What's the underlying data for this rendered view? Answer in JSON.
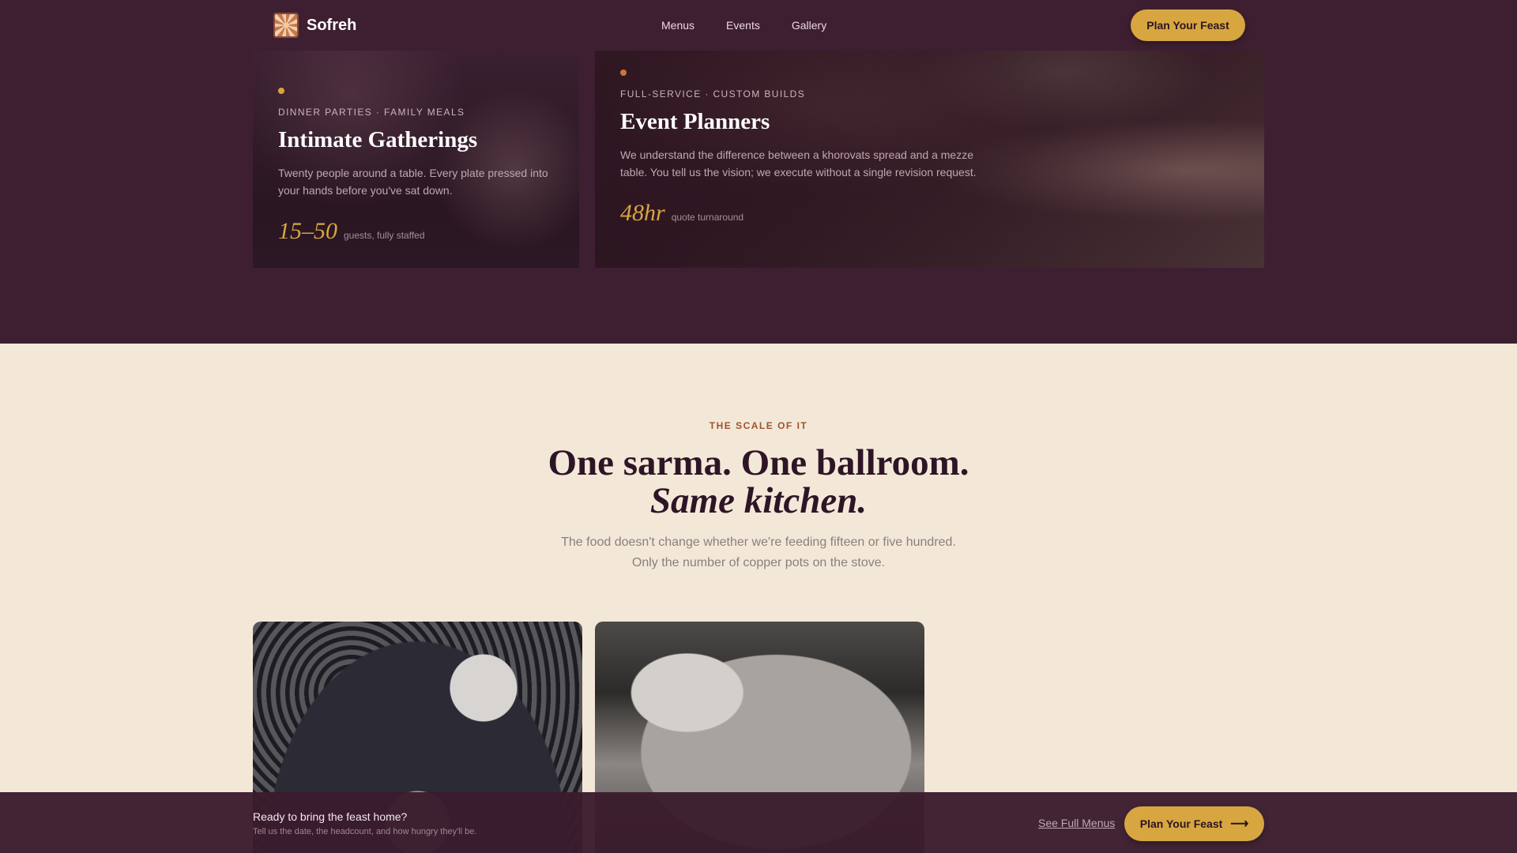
{
  "nav": {
    "brand": "Sofreh",
    "links": [
      "Menus",
      "Events",
      "Gallery"
    ],
    "cta": "Plan Your Feast"
  },
  "cards": [
    {
      "eyebrow": "DINNER PARTIES · FAMILY MEALS",
      "title": "Intimate Gatherings",
      "description": "Twenty people around a table. Every plate pressed into your hands before you've sat down.",
      "stat_value": "15–50",
      "stat_label": "guests, fully staffed"
    },
    {
      "eyebrow": "FULL-SERVICE · CUSTOM BUILDS",
      "title": "Event Planners",
      "description": "We understand the difference between a khorovats spread and a mezze table. You tell us the vision; we execute without a single revision request.",
      "stat_value": "48hr",
      "stat_label": "quote turnaround"
    }
  ],
  "scale_section": {
    "kicker": "THE SCALE OF IT",
    "headline_line1": "One sarma. One ballroom.",
    "headline_line2": "Same kitchen.",
    "subtext_line1": "The food doesn't change whether we're feeding fifteen or five hundred.",
    "subtext_line2": "Only the number of copper pots on the stove."
  },
  "bottom_bar": {
    "title": "Ready to bring the feast home?",
    "subtitle": "Tell us the date, the headcount, and how hungry they'll be.",
    "link": "See Full Menus",
    "cta": "Plan Your Feast",
    "cta_icon": "arrow-right-icon"
  },
  "colors": {
    "plum": "#3e1f31",
    "gold": "#d7a640",
    "cream": "#f3e8d8",
    "rust": "#a0522d"
  }
}
